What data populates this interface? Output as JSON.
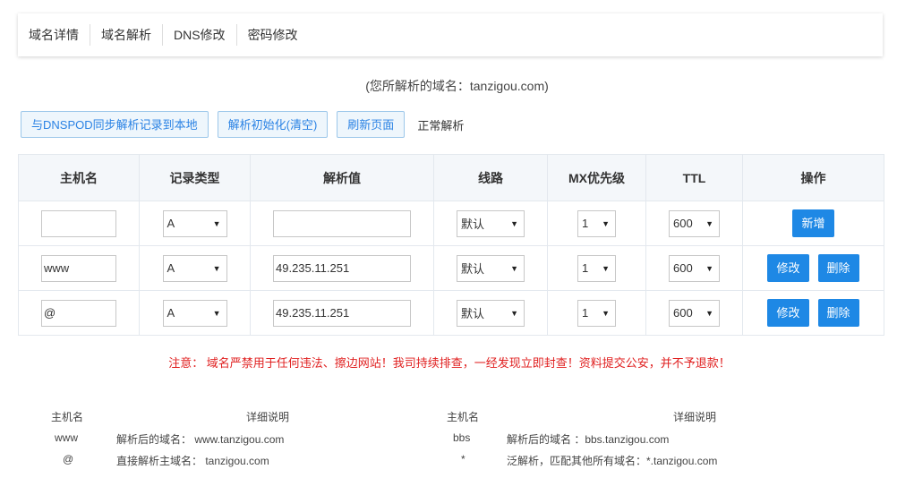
{
  "tabs": [
    "域名详情",
    "域名解析",
    "DNS修改",
    "密码修改"
  ],
  "domain_line": "(您所解析的域名：tanzigou.com)",
  "toolbar": {
    "sync_btn": "与DNSPOD同步解析记录到本地",
    "init_btn": "解析初始化(清空)",
    "refresh_btn": "刷新页面",
    "status": "正常解析"
  },
  "table": {
    "headers": [
      "主机名",
      "记录类型",
      "解析值",
      "线路",
      "MX优先级",
      "TTL",
      "操作"
    ],
    "new_row": {
      "host": "",
      "type": "A",
      "value": "",
      "line": "默认",
      "mx": "1",
      "ttl": "600",
      "add_btn": "新增"
    },
    "rows": [
      {
        "host": "www",
        "type": "A",
        "value": "49.235.11.251",
        "line": "默认",
        "mx": "1",
        "ttl": "600",
        "edit_btn": "修改",
        "delete_btn": "删除"
      },
      {
        "host": "@",
        "type": "A",
        "value": "49.235.11.251",
        "line": "默认",
        "mx": "1",
        "ttl": "600",
        "edit_btn": "修改",
        "delete_btn": "删除"
      }
    ]
  },
  "notice": "注意： 域名严禁用于任何违法、擦边网站！我司持续排查，一经发现立即封查！资料提交公安，并不予退款！",
  "help": {
    "left": {
      "host_header": "主机名",
      "desc_header": "详细说明",
      "rows": [
        {
          "host": "www",
          "desc": "解析后的域名： www.tanzigou.com"
        },
        {
          "host": "@",
          "desc": "直接解析主域名： tanzigou.com"
        }
      ]
    },
    "right": {
      "host_header": "主机名",
      "desc_header": "详细说明",
      "rows": [
        {
          "host": "bbs",
          "desc": "解析后的域名 ：bbs.tanzigou.com"
        },
        {
          "host": "*",
          "desc": "泛解析，匹配其他所有域名：*.tanzigou.com"
        }
      ]
    }
  }
}
